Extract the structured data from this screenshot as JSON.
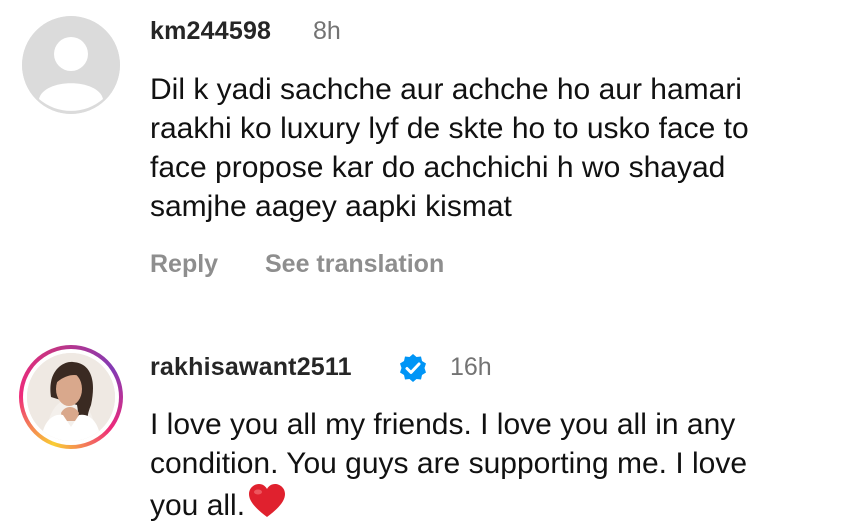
{
  "comments": [
    {
      "username": "km244598",
      "time": "8h",
      "text": "Dil k yadi sachche aur achche ho aur hamari\nraakhi ko luxury lyf de skte ho to usko face to\nface propose kar do  achchichi h wo shayad\nsamjhe aagey aapki kismat",
      "avatar": "default-avatar-icon",
      "actions": {
        "reply": "Reply",
        "translate": "See translation"
      }
    },
    {
      "username": "rakhisawant2511",
      "verified": true,
      "time": "16h",
      "text": "I love you all my friends. I love you all in any\ncondition. You guys are supporting me. I love\nyou all.",
      "avatar": "profile-photo",
      "emoji": "red-heart-icon"
    }
  ],
  "colors": {
    "username": "#262626",
    "meta": "#737373",
    "action": "#8e8e8e",
    "verified": "#0095f6",
    "heart": "#e0212e"
  }
}
